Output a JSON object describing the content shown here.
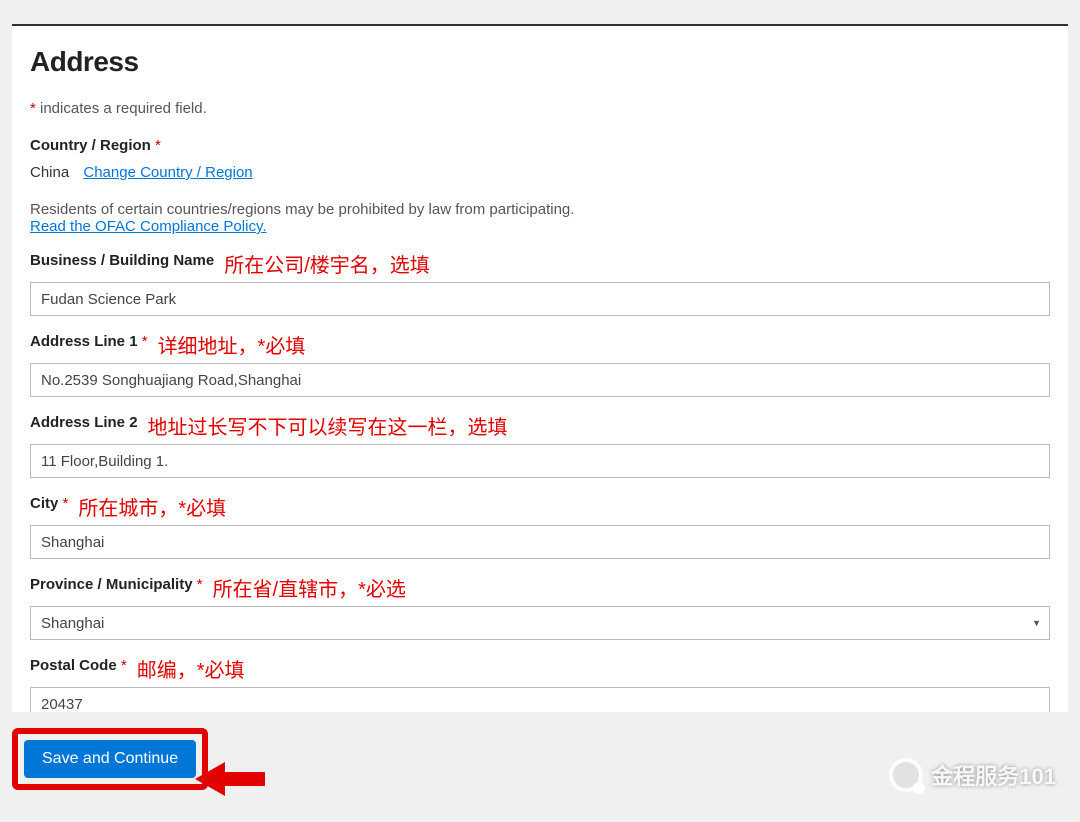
{
  "section_title": "Address",
  "required_note_prefix": "*",
  "required_note_text": " indicates a required field.",
  "country": {
    "label": "Country / Region",
    "value": "China",
    "change_link": "Change Country / Region"
  },
  "compliance": {
    "text": "Residents of certain countries/regions may be prohibited by law from participating.",
    "link": "Read the OFAC Compliance Policy."
  },
  "fields": {
    "business": {
      "label": "Business / Building Name",
      "value": "Fudan Science Park",
      "annotation": "所在公司/楼宇名，选填",
      "required": false
    },
    "address1": {
      "label": "Address Line 1",
      "value": "No.2539 Songhuajiang Road,Shanghai",
      "annotation": "详细地址，*必填",
      "required": true
    },
    "address2": {
      "label": "Address Line 2",
      "value": "11 Floor,Building 1.",
      "annotation": "地址过长写不下可以续写在这一栏，选填",
      "required": false
    },
    "city": {
      "label": "City",
      "value": "Shanghai",
      "annotation": "所在城市，*必填",
      "required": true
    },
    "province": {
      "label": "Province / Municipality",
      "value": "Shanghai",
      "annotation": "所在省/直辖市，*必选",
      "required": true
    },
    "postal": {
      "label": "Postal Code",
      "value": "20437",
      "annotation": "邮编，*必填",
      "required": true
    }
  },
  "save_button": "Save and Continue",
  "watermark": "金程服务101"
}
